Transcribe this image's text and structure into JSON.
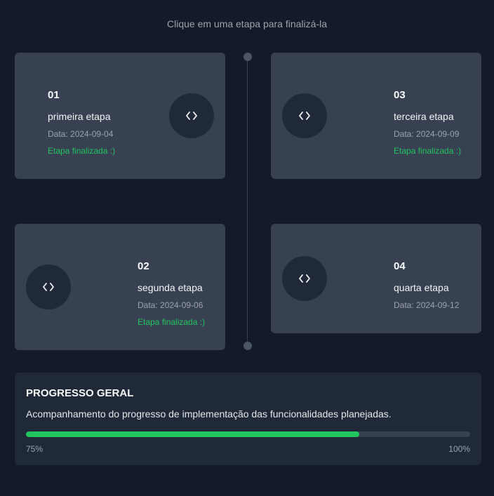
{
  "hint": "Clique em uma etapa para finalizá-la",
  "colors": {
    "background": "#141a27",
    "card": "#374151",
    "panel": "#1f2937",
    "success": "#22c55e",
    "muted": "#9ca3af"
  },
  "steps": [
    {
      "number": "01",
      "title": "primeira etapa",
      "date": "Data: 2024-09-04",
      "status": "Etapa finalizada :)",
      "done": true,
      "icon": "code-icon"
    },
    {
      "number": "02",
      "title": "segunda etapa",
      "date": "Data: 2024-09-06",
      "status": "Etapa finalizada :)",
      "done": true,
      "icon": "code-icon"
    },
    {
      "number": "03",
      "title": "terceira etapa",
      "date": "Data: 2024-09-09",
      "status": "Etapa finalizada :)",
      "done": true,
      "icon": "code-icon"
    },
    {
      "number": "04",
      "title": "quarta etapa",
      "date": "Data: 2024-09-12",
      "status": "",
      "done": false,
      "icon": "code-icon"
    }
  ],
  "progress": {
    "title": "PROGRESSO GERAL",
    "description": "Acompanhamento do progresso de implementação das funcionalidades planejadas.",
    "value_percent": 75,
    "current_label": "75%",
    "max_label": "100%"
  }
}
